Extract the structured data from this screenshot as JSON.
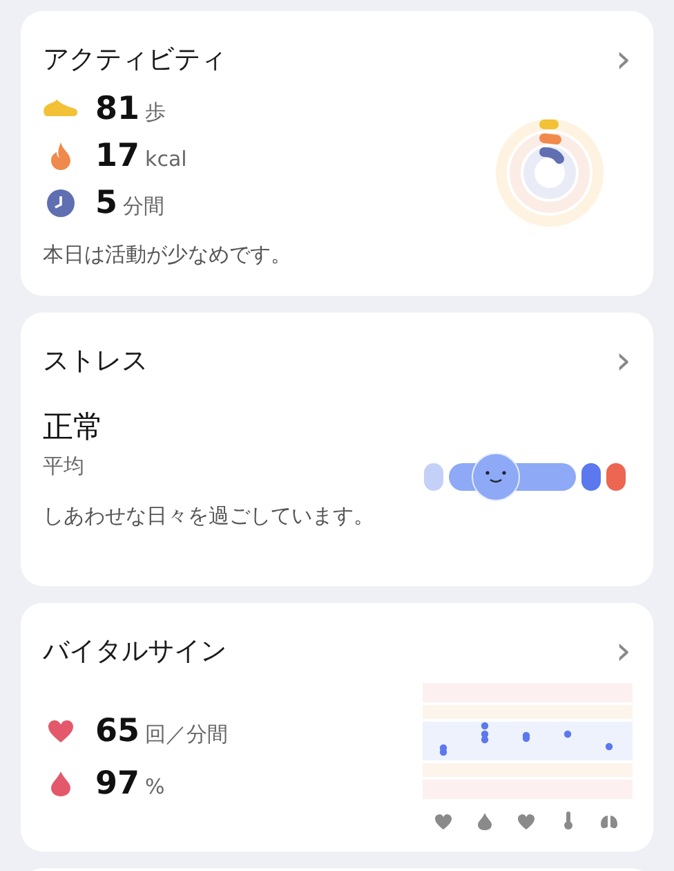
{
  "activity": {
    "title": "アクティビティ",
    "chevron": "›",
    "stats": [
      {
        "kind": "steps",
        "value": "81",
        "unit": "歩"
      },
      {
        "kind": "calories",
        "value": "17",
        "unit": "kcal"
      },
      {
        "kind": "minutes",
        "value": "5",
        "unit": "分間"
      }
    ],
    "message": "本日は活動が少なめです。"
  },
  "stress": {
    "title": "ストレス",
    "chevron": "›",
    "status": "正常",
    "sublabel": "平均",
    "message": "しあわせな日々を過ごしています。"
  },
  "vitals": {
    "title": "バイタルサイン",
    "chevron": "›",
    "stats": [
      {
        "kind": "heart",
        "value": "65",
        "unit": "回／分間"
      },
      {
        "kind": "oxygen",
        "value": "97",
        "unit": "%"
      }
    ]
  }
}
